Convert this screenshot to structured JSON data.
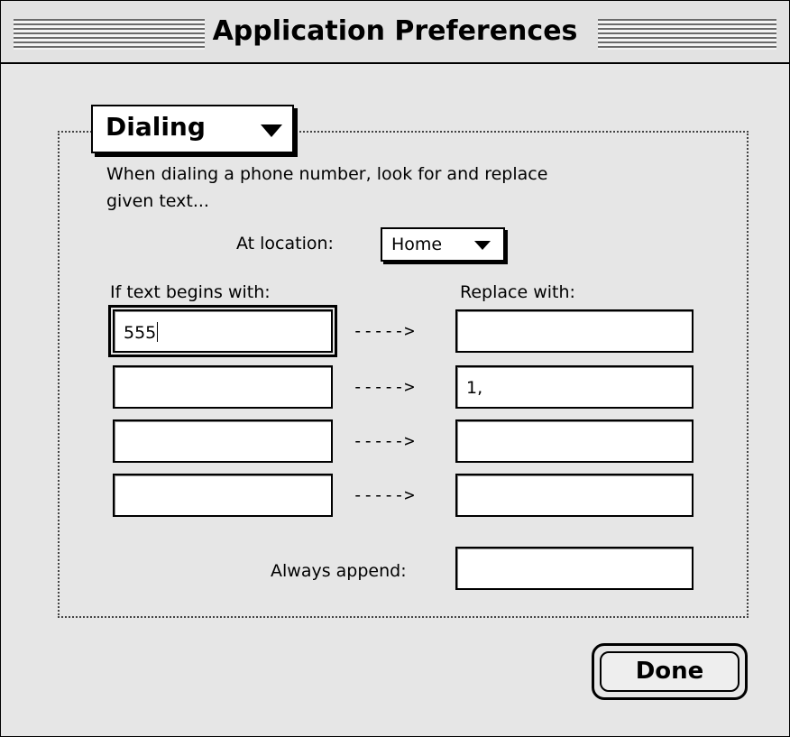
{
  "window": {
    "title": "Application Preferences"
  },
  "section_popup": {
    "value": "Dialing"
  },
  "description": {
    "line1": "When dialing a phone number, look for and replace",
    "line2": "given text..."
  },
  "location": {
    "label": "At location:",
    "value": "Home"
  },
  "columns": {
    "left_header": "If text begins with:",
    "right_header": "Replace with:"
  },
  "rows": [
    {
      "begins_with": "555",
      "arrow": "----->",
      "replace_with": ""
    },
    {
      "begins_with": "",
      "arrow": "----->",
      "replace_with": "1,"
    },
    {
      "begins_with": "",
      "arrow": "----->",
      "replace_with": ""
    },
    {
      "begins_with": "",
      "arrow": "----->",
      "replace_with": ""
    }
  ],
  "append": {
    "label": "Always append:",
    "value": ""
  },
  "done_button": {
    "label": "Done"
  }
}
